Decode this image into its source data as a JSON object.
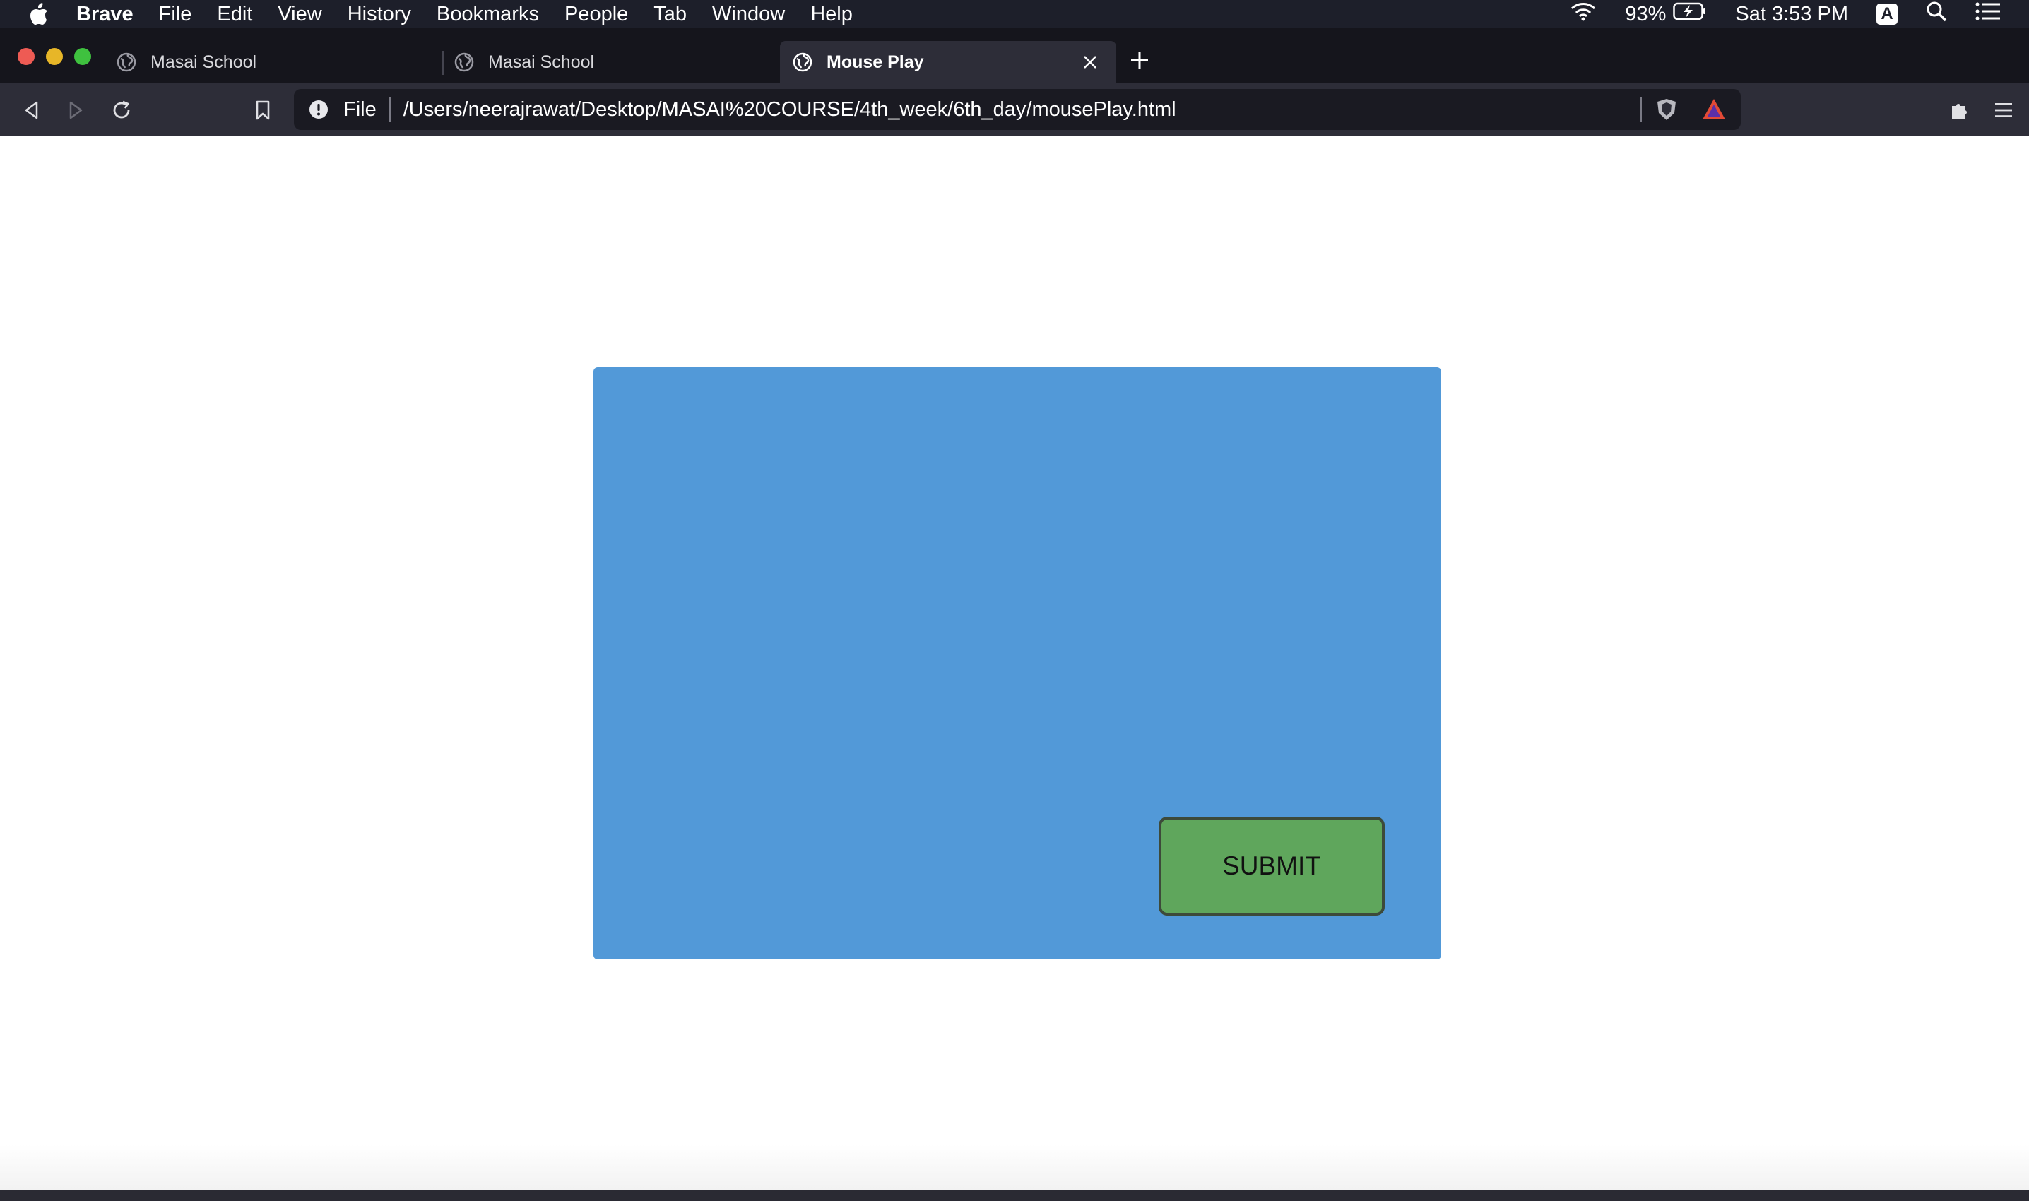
{
  "menubar": {
    "app_name": "Brave",
    "items": [
      "File",
      "Edit",
      "View",
      "History",
      "Bookmarks",
      "People",
      "Tab",
      "Window",
      "Help"
    ],
    "battery": "93%",
    "clock": "Sat 3:53 PM",
    "input_source": "A"
  },
  "tabs": [
    {
      "title": "Masai School",
      "active": false
    },
    {
      "title": "Masai School",
      "active": false
    },
    {
      "title": "Mouse Play",
      "active": true
    }
  ],
  "toolbar": {
    "scheme_label": "File",
    "url": "/Users/neerajrawat/Desktop/MASAI%20COURSE/4th_week/6th_day/mousePlay.html"
  },
  "page": {
    "submit_label": "SUBMIT"
  },
  "colors": {
    "box": "#5299d8",
    "button": "#5fa65c"
  }
}
